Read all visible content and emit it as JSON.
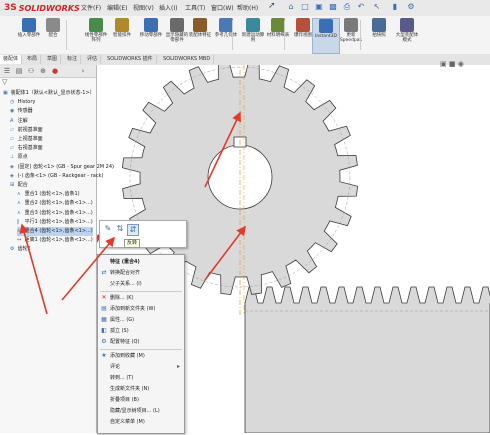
{
  "app": {
    "brand": "SOLIDWORKS",
    "logo_prefix": "3S"
  },
  "menubar": {
    "items": [
      "文件(F)",
      "编辑(E)",
      "视图(V)",
      "插入(I)",
      "工具(T)",
      "窗口(W)",
      "帮助(H)"
    ]
  },
  "quick_access": [
    "home-icon",
    "new-icon",
    "open-icon",
    "save-icon",
    "print-icon",
    "undo-icon",
    "select-icon",
    "rebuild-icon",
    "options-icon"
  ],
  "command_manager": {
    "buttons": [
      {
        "label": "插入零部件",
        "icon": "insert-component-icon",
        "color": "#3a6fb5"
      },
      {
        "label": "配合",
        "icon": "mate-icon",
        "color": "#8a8a8a"
      },
      {
        "label": "线性零部件阵列",
        "icon": "pattern-icon",
        "color": "#4a8a4a"
      },
      {
        "label": "智能扣件",
        "icon": "smart-fastener-icon",
        "color": "#b08a2a"
      },
      {
        "label": "移动零部件",
        "icon": "move-component-icon",
        "color": "#3a6fb5"
      },
      {
        "label": "显示隐藏的零部件",
        "icon": "show-hidden-icon",
        "color": "#6a6a6a"
      },
      {
        "label": "装配体特征",
        "icon": "assembly-feature-icon",
        "color": "#8a5a2a"
      },
      {
        "label": "参考几何体",
        "icon": "reference-geometry-icon",
        "color": "#4a7ab5"
      },
      {
        "label": "新建运动算例",
        "icon": "motion-study-icon",
        "color": "#3a8a9a"
      },
      {
        "label": "材料明细表",
        "icon": "bom-icon",
        "color": "#6a8a3a"
      },
      {
        "label": "爆炸视图",
        "icon": "explode-icon",
        "color": "#b5503a"
      },
      {
        "label": "Instant3D",
        "icon": "instant3d-icon",
        "color": "#3a6fb5"
      },
      {
        "label": "更新Speedpak",
        "icon": "speedpak-icon",
        "color": "#7a7a7a"
      },
      {
        "label": "拍快照",
        "icon": "snapshot-icon",
        "color": "#4a6a9a"
      },
      {
        "label": "大型装配体模式",
        "icon": "large-assembly-icon",
        "color": "#5a5a8a"
      }
    ]
  },
  "tabs": {
    "items": [
      "装配体",
      "布局",
      "草图",
      "标注",
      "评估",
      "SOLIDWORKS 插件",
      "SOLIDWORKS MBD"
    ],
    "active_index": 0
  },
  "feature_tree": {
    "tabs": [
      "feature-manager-icon",
      "property-manager-icon",
      "configuration-manager-icon",
      "dimxpert-icon",
      "display-manager-icon"
    ],
    "filter_icon": "filter-icon",
    "items": [
      {
        "text": "装配体1（默认<默认_显示状态-1>）",
        "icon": "assembly-icon",
        "indent": 0
      },
      {
        "text": "History",
        "icon": "history-icon",
        "indent": 1
      },
      {
        "text": "传感器",
        "icon": "sensor-icon",
        "indent": 1
      },
      {
        "text": "注解",
        "icon": "annotation-icon",
        "indent": 1
      },
      {
        "text": "前视基准面",
        "icon": "plane-icon",
        "indent": 1
      },
      {
        "text": "上视基准面",
        "icon": "plane-icon",
        "indent": 1
      },
      {
        "text": "右视基准面",
        "icon": "plane-icon",
        "indent": 1
      },
      {
        "text": "原点",
        "icon": "origin-icon",
        "indent": 1
      },
      {
        "text": "(固定) 齿轮<1> (GB - Spur gear 2M 24)",
        "icon": "part-icon",
        "indent": 1
      },
      {
        "text": "(-) 齿条<1> (GB - Rackgear - rack)",
        "icon": "part-icon",
        "indent": 1
      },
      {
        "text": "配合",
        "icon": "mates-folder-icon",
        "indent": 1
      },
      {
        "text": "重合1 (齿轮<1>,齿条1)",
        "icon": "mate-coincident-icon",
        "indent": 2
      },
      {
        "text": "重合2 (齿轮<1>,齿条<1>...)",
        "icon": "mate-coincident-icon",
        "indent": 2
      },
      {
        "text": "重合3 (齿轮<1>,齿条<1>...)",
        "icon": "mate-coincident-icon",
        "indent": 2
      },
      {
        "text": "平行1 (齿轮<1>,齿条<1>...)",
        "icon": "mate-parallel-icon",
        "indent": 2
      },
      {
        "text": "重合4 (齿轮<1>,齿条<1>...)",
        "icon": "mate-coincident-icon",
        "indent": 2,
        "selected": true
      },
      {
        "text": "距离1 (齿轮<1>,齿条<1>...)",
        "icon": "mate-distance-icon",
        "indent": 2
      },
      {
        "text": "齿轮1",
        "icon": "gear-mate-icon",
        "indent": 1
      }
    ]
  },
  "context_toolbar": {
    "icons": [
      "edit-feature-icon",
      "suppress-icon",
      "flip-alignment-icon"
    ],
    "tooltip": "反转"
  },
  "context_menu": {
    "items": [
      {
        "label": "特征 (重合4)",
        "icon": "",
        "header": true
      },
      {
        "label": "转换配合对齐",
        "icon": "swap-icon"
      },
      {
        "label": "父子关系... (I)",
        "icon": "",
        "separator_after": true
      },
      {
        "label": "删除... (K)",
        "icon": "delete-icon"
      },
      {
        "label": "添加到新文件夹 (W)",
        "icon": "folder-icon"
      },
      {
        "label": "属性... (G)",
        "icon": "properties-icon"
      },
      {
        "label": "孤立 (S)",
        "icon": "isolate-icon"
      },
      {
        "label": "配置特征 (Q)",
        "icon": "configure-icon",
        "separator_after": true
      },
      {
        "label": "添加到收藏 (M)",
        "icon": "favorite-icon"
      },
      {
        "label": "评论",
        "icon": "",
        "submenu": true
      },
      {
        "label": "转到... (T)",
        "icon": ""
      },
      {
        "label": "生成新文件夹 (N)",
        "icon": ""
      },
      {
        "label": "折叠项目 (B)",
        "icon": ""
      },
      {
        "label": "隐藏/显示树项目... (L)",
        "icon": ""
      },
      {
        "label": "自定义菜单 (M)",
        "icon": ""
      }
    ]
  },
  "viewport": {
    "gear": {
      "teeth": 24,
      "color": "#d9d9d9",
      "edge": "#3c3c3c"
    },
    "rack": {
      "color": "#d9d9d9"
    },
    "annotation_color": "#e53a2a",
    "axis_color": "#e8a23a",
    "hud_icons": [
      "view-orientation-icon",
      "display-style-icon",
      "hide-show-icon"
    ]
  }
}
